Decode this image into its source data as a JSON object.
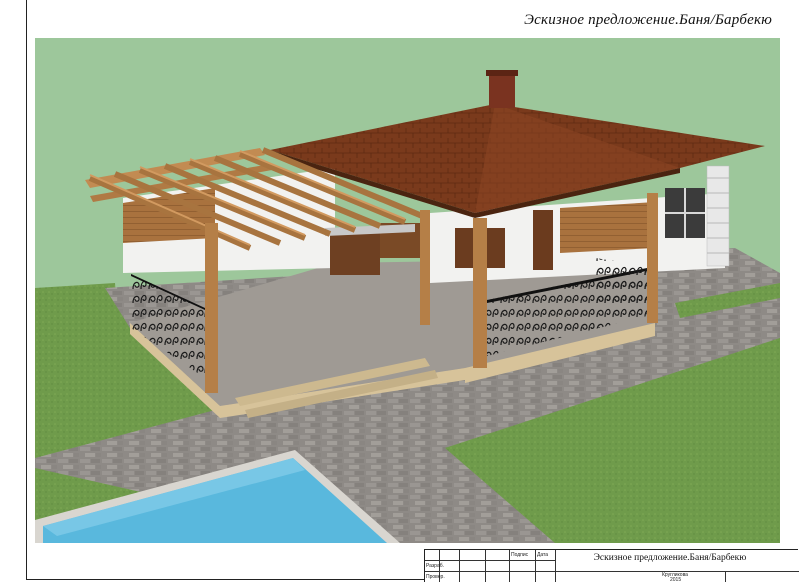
{
  "drawing": {
    "title": "Эскизное предложение.Баня/Барбекю"
  },
  "title_block": {
    "title": "Эскизное предложение.Баня/Барбекю",
    "col_signature": "Подпис",
    "col_date": "Дата",
    "row_developed": "Разраб.",
    "row_checked": "Провер.",
    "author": "Кругликова",
    "year": "2015"
  },
  "colors": {
    "grass": "#6f9b4b",
    "background": "#9dc79b",
    "paving": "#8e8a86",
    "pool_water": "#59b8dd",
    "roof": "#7a3a1c",
    "timber": "#b9844d",
    "railing": "#1b1b1b"
  }
}
